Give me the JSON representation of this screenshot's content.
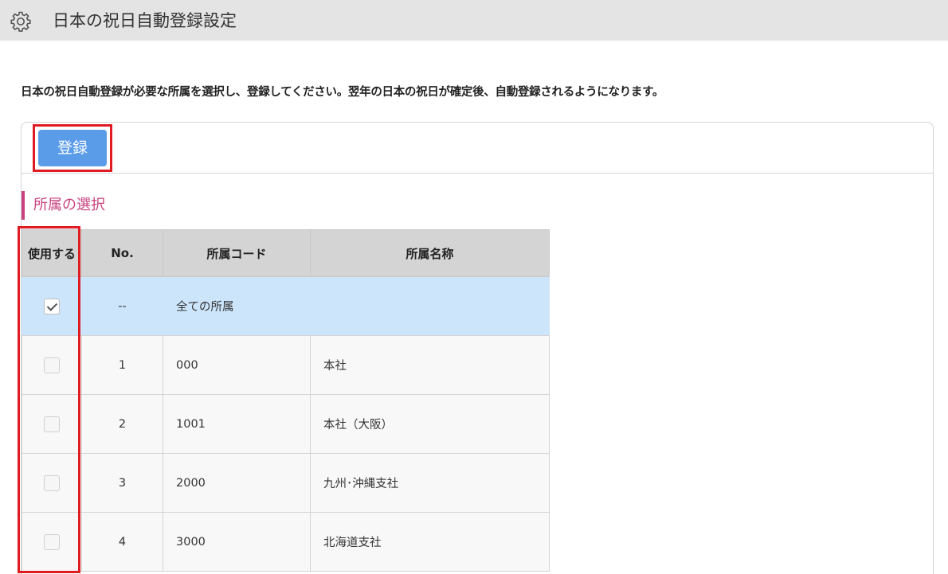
{
  "header": {
    "title": "日本の祝日自動登録設定",
    "icon": "gear-icon"
  },
  "description": "日本の祝日自動登録が必要な所属を選択し、登録してください。翌年の日本の祝日が確定後、自動登録されるようになります。",
  "toolbar": {
    "register_label": "登録",
    "button_color": "#5b9ce8"
  },
  "section": {
    "title": "所属の選択",
    "accent_color": "#c9417f"
  },
  "table": {
    "headers": {
      "use": "使用する",
      "no": "No.",
      "code": "所属コード",
      "name": "所属名称"
    },
    "all_row": {
      "no": "--",
      "label": "全ての所属",
      "checked": true
    },
    "rows": [
      {
        "no": "1",
        "code": "000",
        "name": "本社",
        "checked": false
      },
      {
        "no": "2",
        "code": "1001",
        "name": "本社（大阪）",
        "checked": false
      },
      {
        "no": "3",
        "code": "2000",
        "name": "九州･沖縄支社",
        "checked": false
      },
      {
        "no": "4",
        "code": "3000",
        "name": "北海道支社",
        "checked": false
      }
    ]
  },
  "highlight_color": "#e11b22"
}
